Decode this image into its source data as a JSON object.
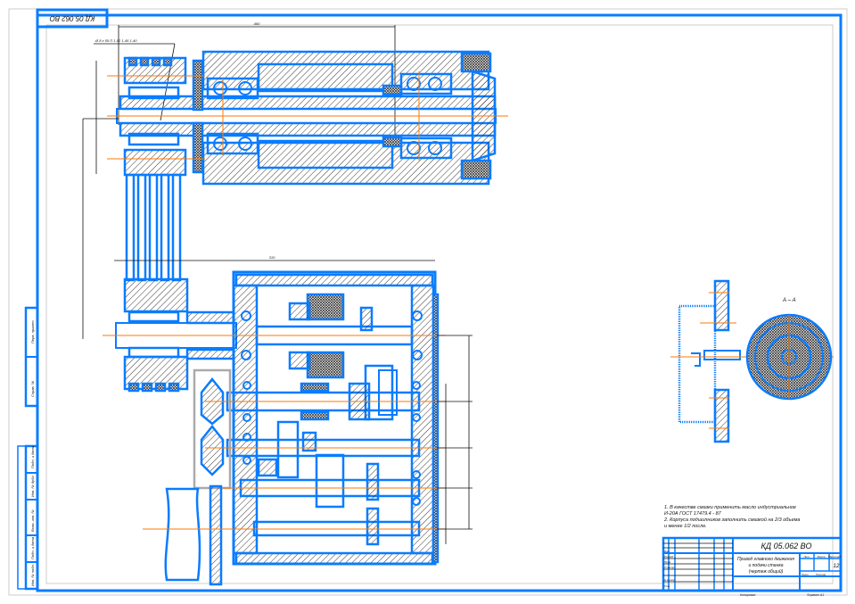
{
  "drawing": {
    "stamp_code": "КД 05.062 ВО",
    "section_label": "А – А",
    "dimension_top_length": "460",
    "dimension_belt": "Ø 8 х 55 П 1-52 1-45 1-40",
    "dimension_gearbox_width": "310",
    "notes": [
      "1. В качестве смазки применить масло индустриальное",
      "   И-20А ГОСТ 17479.4 - 87",
      "2. Корпуса подшипников заполнить смазкой на 2/3 объема",
      "   и менее 1/2 после."
    ]
  },
  "title_block": {
    "code": "КД 05.062 ВО",
    "name_line1": "Привод главного движения",
    "name_line2": "и подачи станка",
    "name_line3": "(чертеж общий)",
    "sheet_count": "12",
    "col_lit": "Лит.",
    "col_mass": "Масса",
    "col_scale": "Масштаб",
    "col_sheet": "Лист",
    "col_sheets": "Листов",
    "rows": [
      "Изм.",
      "Разраб.",
      "Пров.",
      "Т.контр.",
      "Н.контр.",
      "Утв."
    ],
    "copied": "Копировал",
    "format": "Формат А1"
  },
  "sidebar": {
    "labels": [
      "Перв. примен.",
      "Справ. №",
      "Подп. и дата",
      "Инв. № дубл.",
      "Взам. инв. №",
      "Подп. и дата",
      "Инв. № подл."
    ]
  }
}
